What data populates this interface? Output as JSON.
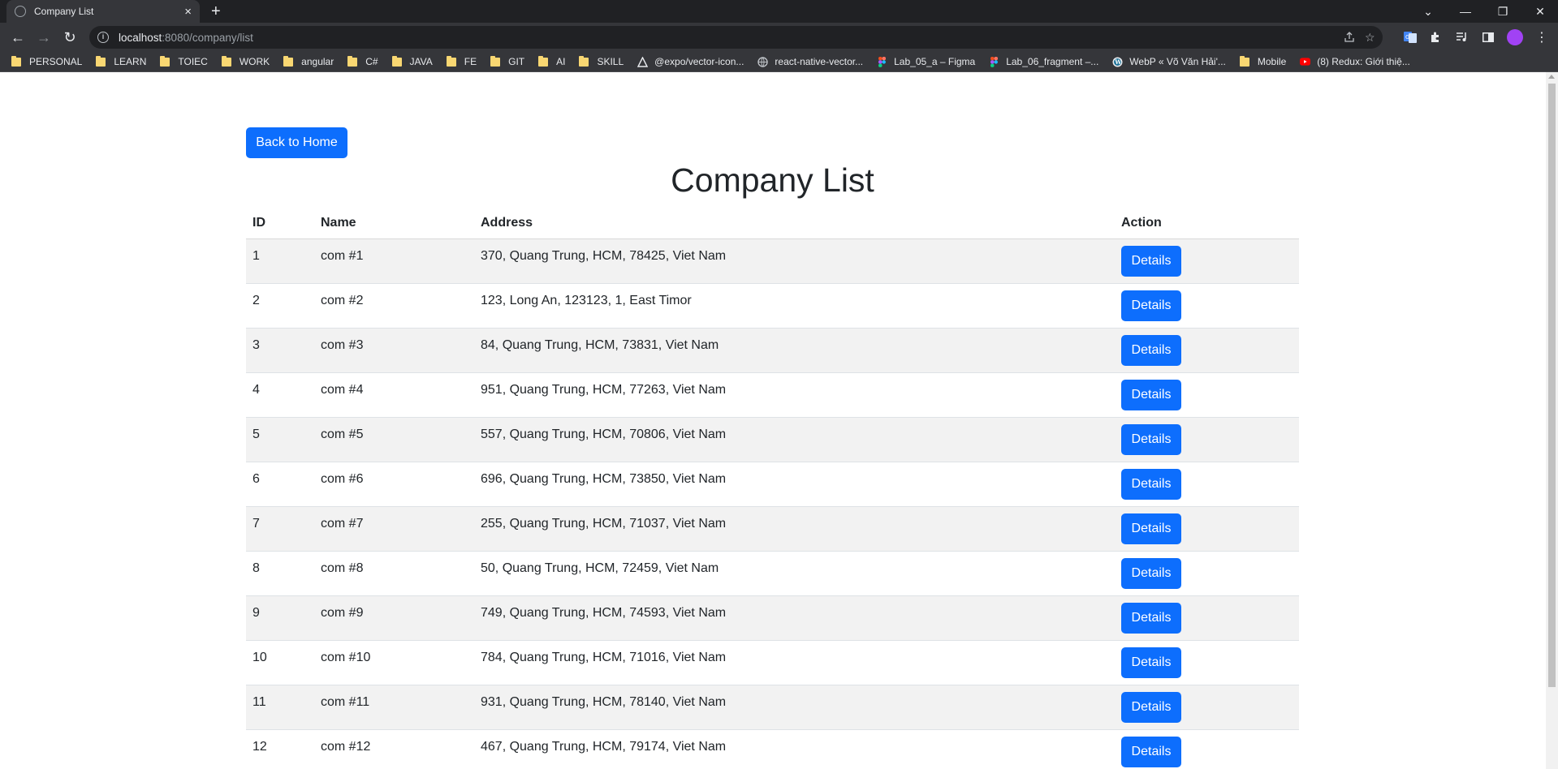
{
  "browser": {
    "tab_title": "Company List",
    "tab_close": "×",
    "new_tab": "+",
    "window_controls": {
      "dropdown": "⌄",
      "minimize": "—",
      "restore": "❐",
      "close": "✕"
    },
    "nav": {
      "back": "←",
      "forward": "→",
      "reload": "↻"
    },
    "url_host": "localhost",
    "url_rest": ":8080/company/list",
    "bookmarks": [
      {
        "label": "PERSONAL",
        "icon": "folder-icon"
      },
      {
        "label": "LEARN",
        "icon": "folder-icon"
      },
      {
        "label": "TOIEC",
        "icon": "folder-icon"
      },
      {
        "label": "WORK",
        "icon": "folder-icon"
      },
      {
        "label": "angular",
        "icon": "folder-icon"
      },
      {
        "label": "C#",
        "icon": "folder-icon"
      },
      {
        "label": "JAVA",
        "icon": "folder-icon"
      },
      {
        "label": "FE",
        "icon": "folder-icon"
      },
      {
        "label": "GIT",
        "icon": "folder-icon"
      },
      {
        "label": "AI",
        "icon": "folder-icon"
      },
      {
        "label": "SKILL",
        "icon": "folder-icon"
      },
      {
        "label": "@expo/vector-icon...",
        "icon": "expo-icon"
      },
      {
        "label": "react-native-vector...",
        "icon": "globe-icon"
      },
      {
        "label": "Lab_05_a – Figma",
        "icon": "figma-icon"
      },
      {
        "label": "Lab_06_fragment –...",
        "icon": "figma-icon"
      },
      {
        "label": "WebP « Võ Văn Hải'...",
        "icon": "wordpress-icon"
      },
      {
        "label": "Mobile",
        "icon": "folder-icon"
      },
      {
        "label": "(8) Redux: Giới thiệ...",
        "icon": "youtube-icon"
      }
    ]
  },
  "page": {
    "back_button": "Back to Home",
    "title": "Company List",
    "table": {
      "headers": {
        "id": "ID",
        "name": "Name",
        "address": "Address",
        "action": "Action"
      },
      "rows": [
        {
          "id": "1",
          "name": "com #1",
          "address": "370, Quang Trung, HCM, 78425, Viet Nam",
          "action": "Details"
        },
        {
          "id": "2",
          "name": "com #2",
          "address": "123, Long An, 123123, 1, East Timor",
          "action": "Details"
        },
        {
          "id": "3",
          "name": "com #3",
          "address": "84, Quang Trung, HCM, 73831, Viet Nam",
          "action": "Details"
        },
        {
          "id": "4",
          "name": "com #4",
          "address": "951, Quang Trung, HCM, 77263, Viet Nam",
          "action": "Details"
        },
        {
          "id": "5",
          "name": "com #5",
          "address": "557, Quang Trung, HCM, 70806, Viet Nam",
          "action": "Details"
        },
        {
          "id": "6",
          "name": "com #6",
          "address": "696, Quang Trung, HCM, 73850, Viet Nam",
          "action": "Details"
        },
        {
          "id": "7",
          "name": "com #7",
          "address": "255, Quang Trung, HCM, 71037, Viet Nam",
          "action": "Details"
        },
        {
          "id": "8",
          "name": "com #8",
          "address": "50, Quang Trung, HCM, 72459, Viet Nam",
          "action": "Details"
        },
        {
          "id": "9",
          "name": "com #9",
          "address": "749, Quang Trung, HCM, 74593, Viet Nam",
          "action": "Details"
        },
        {
          "id": "10",
          "name": "com #10",
          "address": "784, Quang Trung, HCM, 71016, Viet Nam",
          "action": "Details"
        },
        {
          "id": "11",
          "name": "com #11",
          "address": "931, Quang Trung, HCM, 78140, Viet Nam",
          "action": "Details"
        },
        {
          "id": "12",
          "name": "com #12",
          "address": "467, Quang Trung, HCM, 79174, Viet Nam",
          "action": "Details"
        }
      ]
    }
  },
  "colors": {
    "primary": "#0d6efd",
    "stripe": "#f2f2f2",
    "chrome_dark": "#202124",
    "chrome": "#35363a"
  }
}
